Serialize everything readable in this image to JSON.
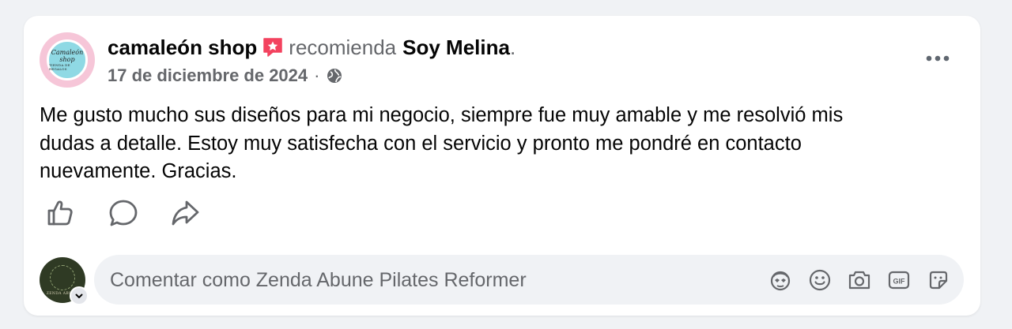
{
  "post": {
    "author": "camaleón shop",
    "action_word": "recomienda",
    "target": "Soy Melina",
    "end_punct": ".",
    "date": "17 de diciembre de 2024",
    "separator": "·",
    "avatar_text_line1": "Camaleón",
    "avatar_text_line2": "shop",
    "avatar_text_line3": "TIENDA DE REGALOS",
    "icons": {
      "badge": "recommend-star-icon",
      "privacy": "globe-icon",
      "more": "more-options-icon"
    },
    "text_lines": [
      "Me gusto mucho sus diseños para mi negocio, siempre fue muy amable y me resolvió mis",
      "dudas a detalle. Estoy muy satisfecha con el servicio y pronto me pondré en contacto",
      "nuevamente. Gracias."
    ]
  },
  "actions": [
    {
      "name": "like",
      "icon": "thumbs-up-icon"
    },
    {
      "name": "comment",
      "icon": "comment-bubble-icon"
    },
    {
      "name": "share",
      "icon": "share-arrow-icon"
    }
  ],
  "comment": {
    "placeholder": "Comentar como Zenda Abune Pilates Reformer",
    "commenter_avatar_text": "ZENDA ABUNE",
    "icons": [
      "avatar-sticker-icon",
      "emoji-icon",
      "camera-icon",
      "gif-icon",
      "sticker-icon"
    ]
  },
  "colors": {
    "page_bg": "#f0f2f5",
    "card_bg": "#ffffff",
    "primary_text": "#050505",
    "secondary_text": "#65676b",
    "badge_pink": "#f3425f"
  }
}
